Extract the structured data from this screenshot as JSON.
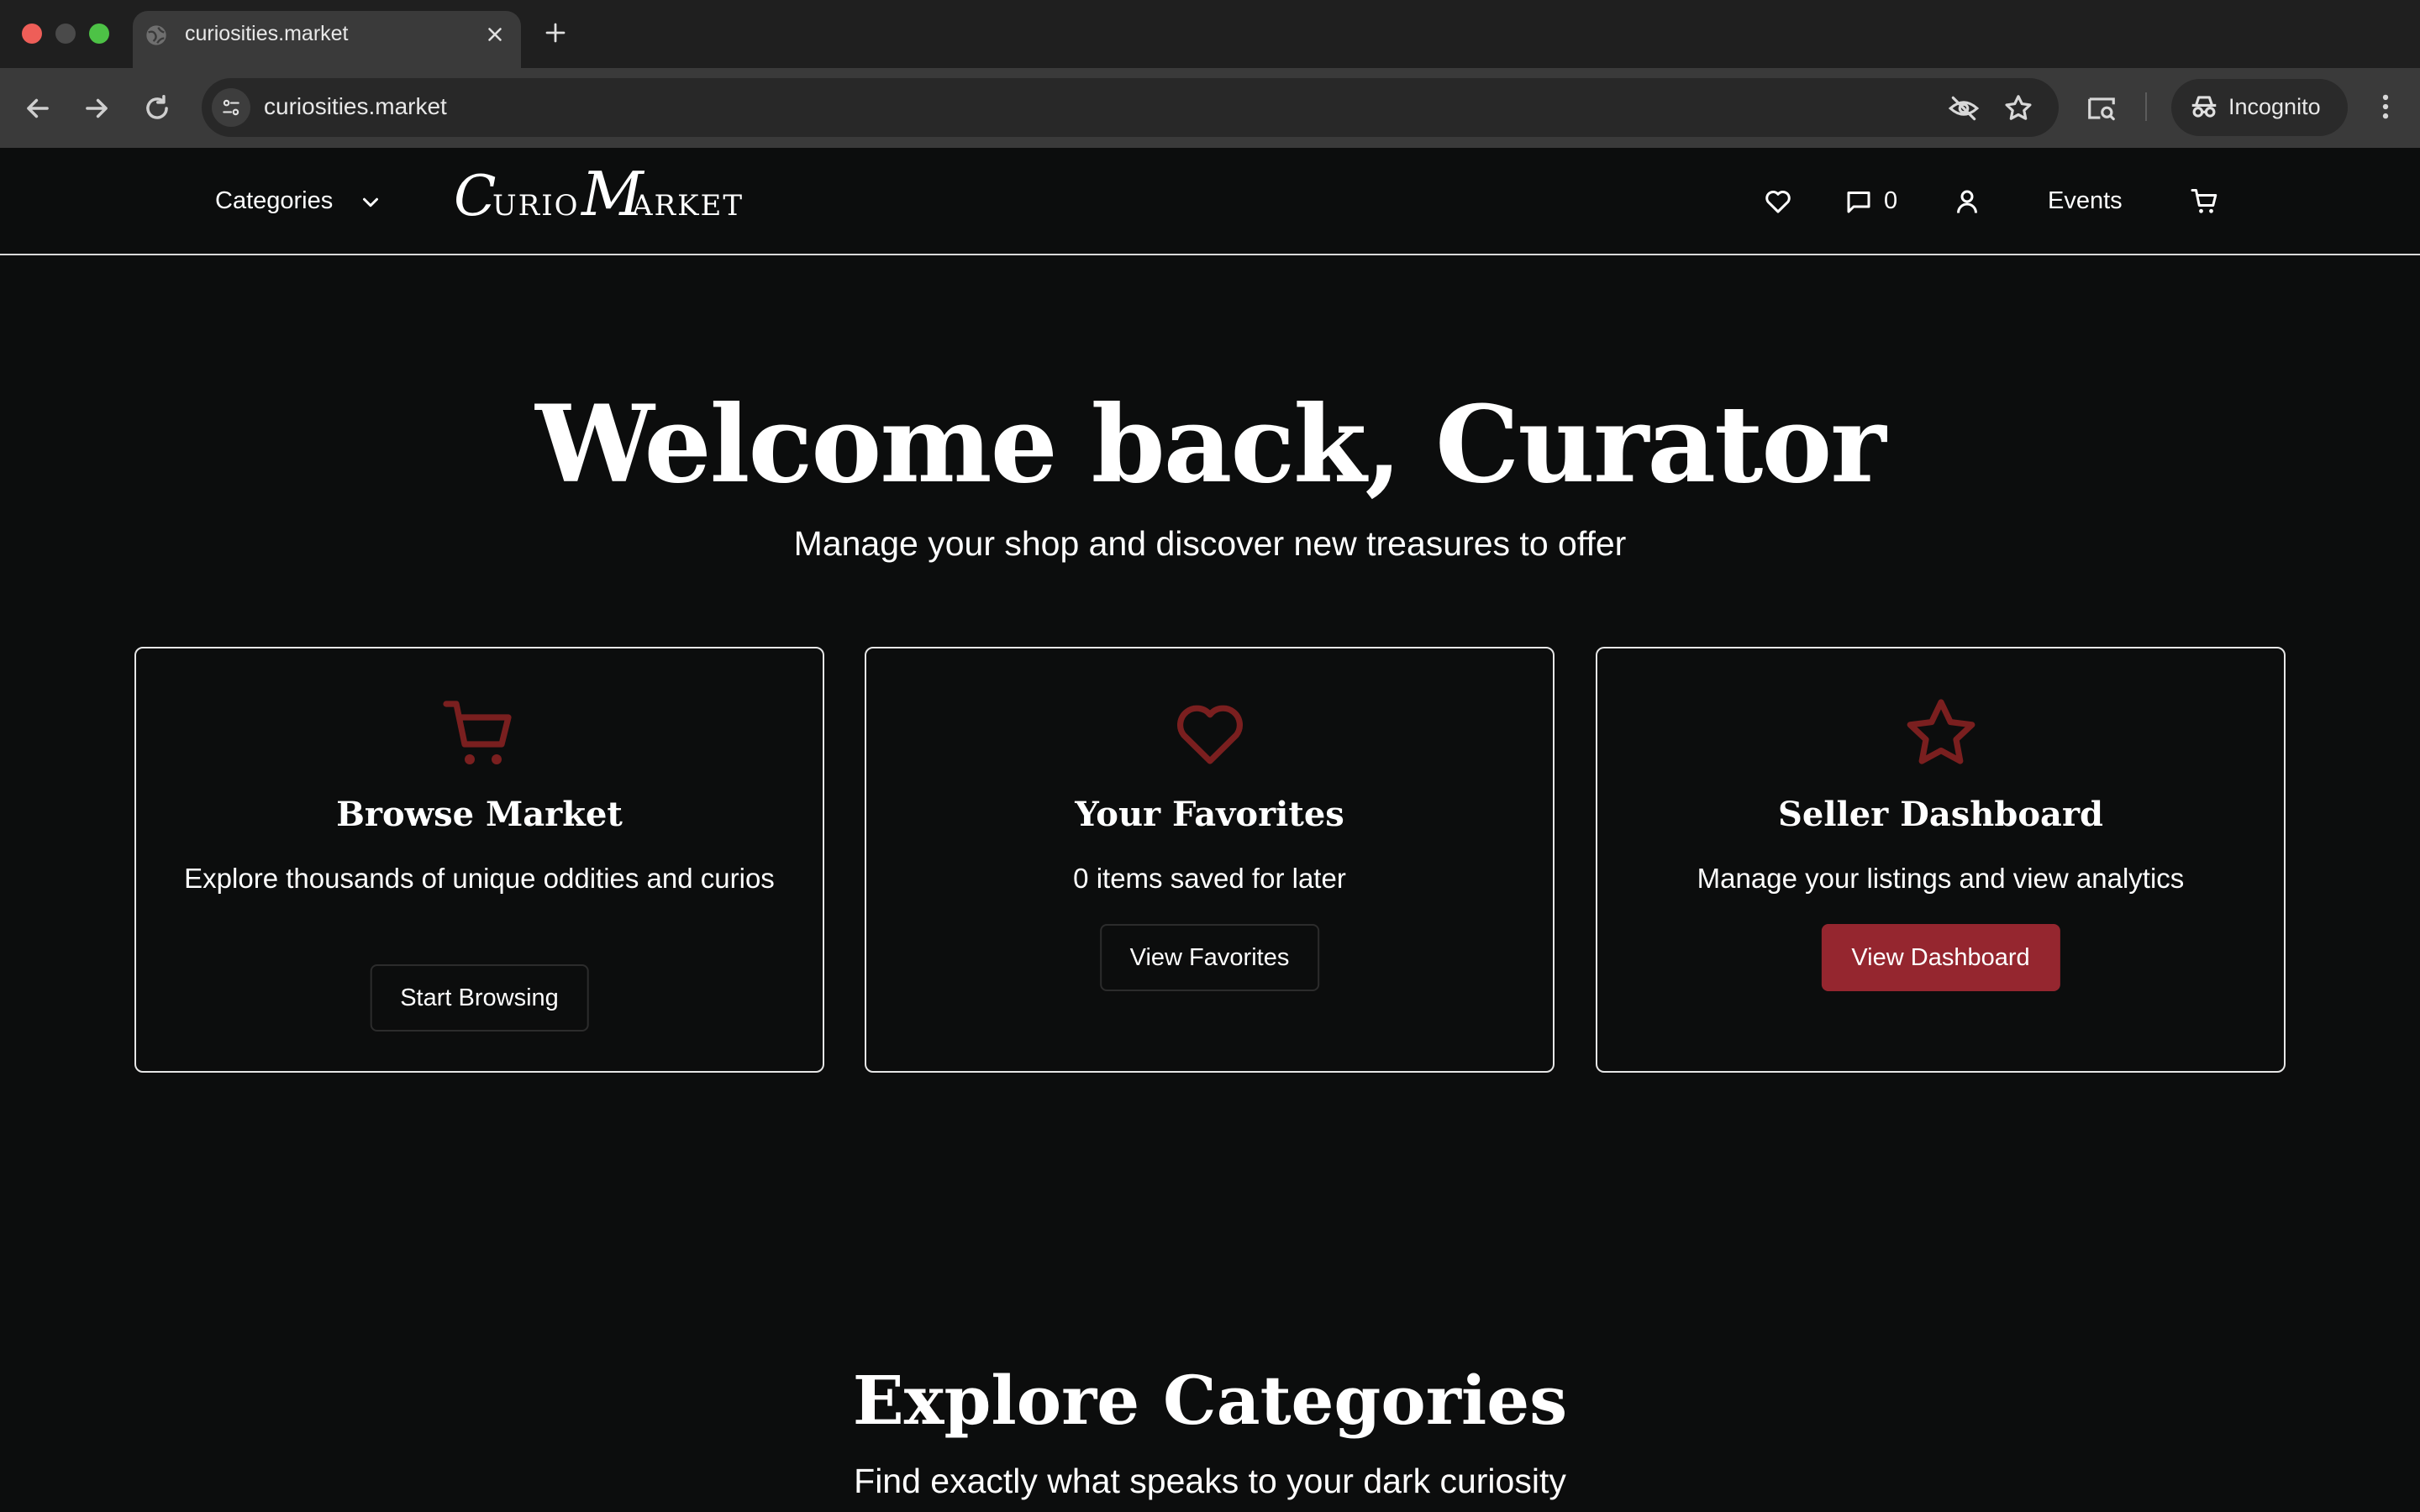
{
  "browser": {
    "tab_title": "curiosities.market",
    "url": "curiosities.market",
    "incognito_label": "Incognito"
  },
  "header": {
    "categories_label": "Categories",
    "logo_text": "Curio Market",
    "messages_count": "0",
    "events_label": "Events"
  },
  "hero": {
    "title": "Welcome back, Curator",
    "subtitle": "Manage your shop and discover new treasures to offer"
  },
  "cards": [
    {
      "icon": "cart-icon",
      "title": "Browse Market",
      "description": "Explore thousands of unique oddities and curios",
      "button": "Start Browsing"
    },
    {
      "icon": "heart-icon",
      "title": "Your Favorites",
      "description": "0 items saved for later",
      "button": "View Favorites"
    },
    {
      "icon": "star-icon",
      "title": "Seller Dashboard",
      "description": "Manage your listings and view analytics",
      "button": "View Dashboard"
    }
  ],
  "categories_section": {
    "title": "Explore Categories",
    "subtitle": "Find exactly what speaks to your dark curiosity"
  },
  "colors": {
    "background": "#0c0d0d",
    "accent": "#95262f",
    "icon_accent": "#7a1f1f"
  }
}
